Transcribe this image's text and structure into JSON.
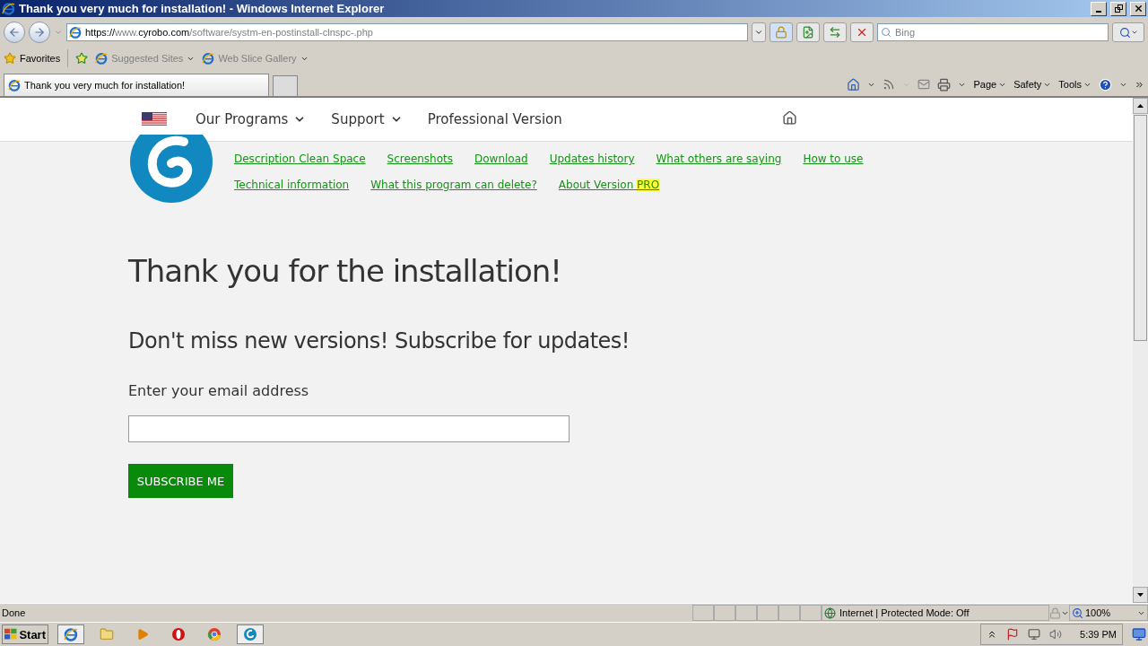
{
  "window": {
    "title": "Thank you very much for installation! - Windows Internet Explorer"
  },
  "address_bar": {
    "url_scheme": "https://",
    "url_host_prefix": "www.",
    "url_domain": "cyrobo.com",
    "url_path": "/software/systm-en-postinstall-clnspc-.php"
  },
  "search": {
    "placeholder": "Bing"
  },
  "favorites_bar": {
    "favorites": "Favorites",
    "links": [
      "Suggested Sites",
      "Web Slice Gallery"
    ]
  },
  "tabs": [
    {
      "label": "Thank you very much for installation!",
      "selected": true
    }
  ],
  "command_bar": [
    "Page",
    "Safety",
    "Tools"
  ],
  "site_nav": [
    {
      "label": "Our Programs",
      "dropdown": true
    },
    {
      "label": "Support",
      "dropdown": true
    },
    {
      "label": "Professional Version",
      "dropdown": false
    }
  ],
  "product_links": [
    [
      {
        "label": "Description Clean Space"
      },
      {
        "label": "Screenshots"
      },
      {
        "label": "Download"
      },
      {
        "label": "Updates history"
      },
      {
        "label": "What others are saying"
      },
      {
        "label": "How to use"
      }
    ],
    [
      {
        "label": "Technical information"
      },
      {
        "label": "What this program can delete?"
      },
      {
        "label": "About Version",
        "highlight": "PRO"
      }
    ]
  ],
  "heading": "Thank you for the installation!",
  "subheading": "Don't miss new versions! Subscribe for updates!",
  "email_label": "Enter your email address",
  "subscribe_button": "SUBSCRIBE ME",
  "status_bar": {
    "status": "Done",
    "zone": "Internet | Protected Mode: Off",
    "zoom": "100%"
  },
  "taskbar": {
    "start": "Start",
    "clock": "5:39 PM"
  }
}
